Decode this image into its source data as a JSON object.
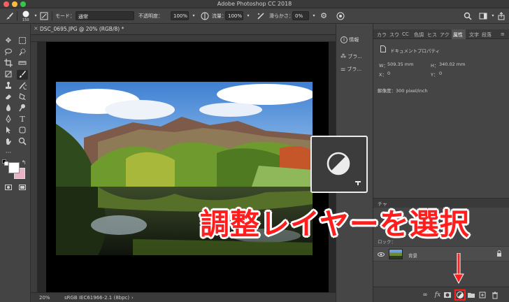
{
  "window": {
    "title": "Adobe Photoshop CC 2018"
  },
  "options_bar": {
    "brush_size": "150",
    "mode_label": "モード：",
    "mode_value": "通常",
    "opacity_label": "不透明度：",
    "opacity_value": "100%",
    "flow_label": "流量：",
    "flow_value": "100%",
    "smoothing_label": "滑らかさ：",
    "smoothing_value": "0%"
  },
  "document": {
    "tab_title": "DSC_0695.JPG @ 20% (RGB/8) *",
    "zoom": "20%",
    "color_profile": "sRGB IEC61966-2.1 (8bpc)"
  },
  "dock": {
    "items": [
      {
        "label": "情報",
        "icon": "info-icon"
      },
      {
        "label": "ブラ...",
        "icon": "brush-icon"
      },
      {
        "label": "ブラ...",
        "icon": "brush-settings-icon"
      }
    ]
  },
  "right_panel": {
    "tabs": [
      "カラ",
      "スウ",
      "CC",
      "色調",
      "ヒス",
      "アク",
      "属性",
      "文字",
      "段落"
    ],
    "active_tab": "属性",
    "properties": {
      "title": "ドキュメントプロパティ",
      "w_label": "W：",
      "w_value": "509.35 mm",
      "h_label": "H：",
      "h_value": "340.02 mm",
      "x_label": "X：",
      "x_value": "0",
      "y_label": "Y：",
      "y_value": "0",
      "resolution": "解像度：300 pixel/inch"
    }
  },
  "layers": {
    "panel_tab": "チャ",
    "lock_label": "ロック：",
    "layer_name": "背景"
  },
  "annotation": {
    "banner": "調整レイヤーを選択",
    "highlight_color": "#ff1e1e"
  }
}
